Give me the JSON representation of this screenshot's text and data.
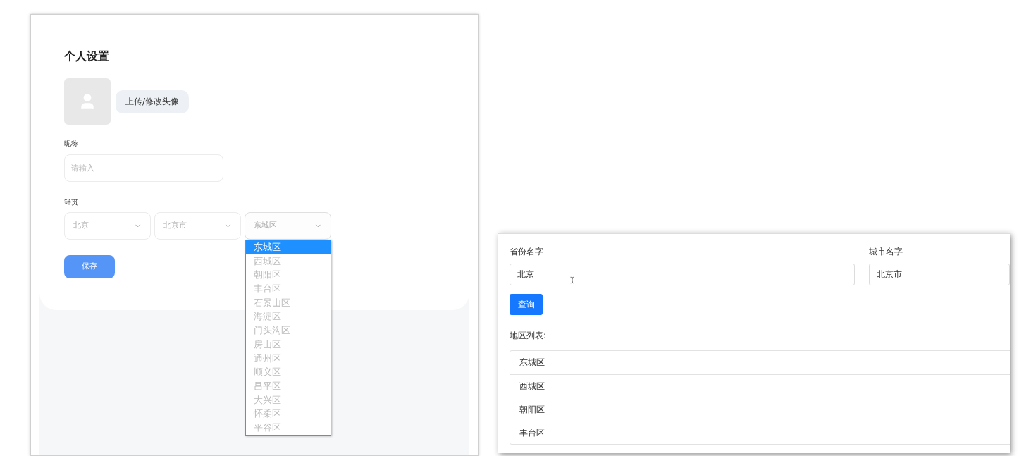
{
  "settings_panel": {
    "title": "个人设置",
    "upload_button": "上传/修改头像",
    "nickname": {
      "label": "昵称",
      "placeholder": "请输入"
    },
    "hometown": {
      "label": "籍贯",
      "selects": [
        {
          "value": "北京",
          "expanded": false
        },
        {
          "value": "北京市",
          "expanded": false
        },
        {
          "value": "东城区",
          "expanded": true,
          "options": [
            {
              "label": "东城区",
              "selected": true
            },
            {
              "label": "西城区",
              "selected": false
            },
            {
              "label": "朝阳区",
              "selected": false
            },
            {
              "label": "丰台区",
              "selected": false
            },
            {
              "label": "石景山区",
              "selected": false
            },
            {
              "label": "海淀区",
              "selected": false
            },
            {
              "label": "门头沟区",
              "selected": false
            },
            {
              "label": "房山区",
              "selected": false
            },
            {
              "label": "通州区",
              "selected": false
            },
            {
              "label": "顺义区",
              "selected": false
            },
            {
              "label": "昌平区",
              "selected": false
            },
            {
              "label": "大兴区",
              "selected": false
            },
            {
              "label": "怀柔区",
              "selected": false
            },
            {
              "label": "平谷区",
              "selected": false
            }
          ]
        }
      ]
    },
    "save_button": "保存"
  },
  "query_panel": {
    "province": {
      "label": "省份名字",
      "value": "北京"
    },
    "city": {
      "label": "城市名字",
      "value": "北京市"
    },
    "query_button": "查询",
    "list_label": "地区列表:",
    "districts": [
      "东城区",
      "西城区",
      "朝阳区",
      "丰台区"
    ]
  }
}
